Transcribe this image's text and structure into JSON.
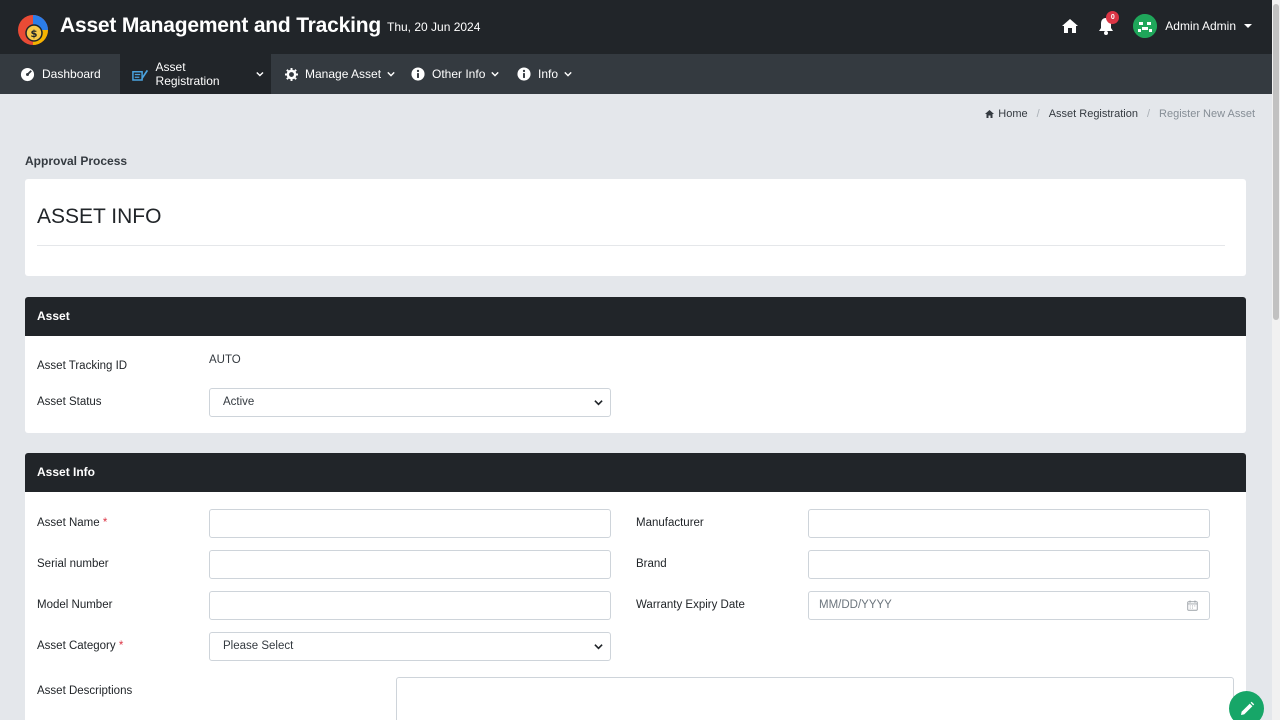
{
  "header": {
    "app_title": "Asset Management and Tracking",
    "date": "Thu, 20 Jun 2024",
    "notification_count": "0",
    "user_name": "Admin Admin",
    "icons": [
      "app-logo",
      "home-icon",
      "bell-icon",
      "avatar",
      "caret-down-icon"
    ]
  },
  "nav": {
    "items": [
      {
        "label": "Dashboard",
        "icon": "dashboard-icon",
        "active": false
      },
      {
        "label": "Asset Registration",
        "icon": "register-icon",
        "active": true
      },
      {
        "label": "Manage Asset",
        "icon": "gear-icon",
        "active": false
      },
      {
        "label": "Other Info",
        "icon": "info-icon",
        "active": false
      },
      {
        "label": "Info",
        "icon": "info-icon",
        "active": false
      }
    ]
  },
  "breadcrumb": {
    "home": "Home",
    "parent": "Asset Registration",
    "current": "Register New Asset"
  },
  "page": {
    "section_heading": "Approval Process",
    "card_title": "ASSET INFO"
  },
  "asset": {
    "heading": "Asset",
    "tracking_id_label": "Asset Tracking ID",
    "tracking_id_value": "AUTO",
    "status_label": "Asset Status",
    "status_value": "Active"
  },
  "asset_info": {
    "heading": "Asset Info",
    "name_label": "Asset Name",
    "serial_label": "Serial number",
    "model_label": "Model Number",
    "category_label": "Asset Category",
    "category_value": "Please Select",
    "manufacturer_label": "Manufacturer",
    "brand_label": "Brand",
    "warranty_label": "Warranty Expiry Date",
    "warranty_placeholder": "MM/DD/YYYY",
    "descriptions_label": "Asset Descriptions",
    "required_marker": "*"
  },
  "colors": {
    "header_bg": "#212529",
    "nav_bg": "#343a40",
    "page_bg": "#e4e7eb",
    "badge": "#dc3545",
    "fab": "#17a668"
  }
}
